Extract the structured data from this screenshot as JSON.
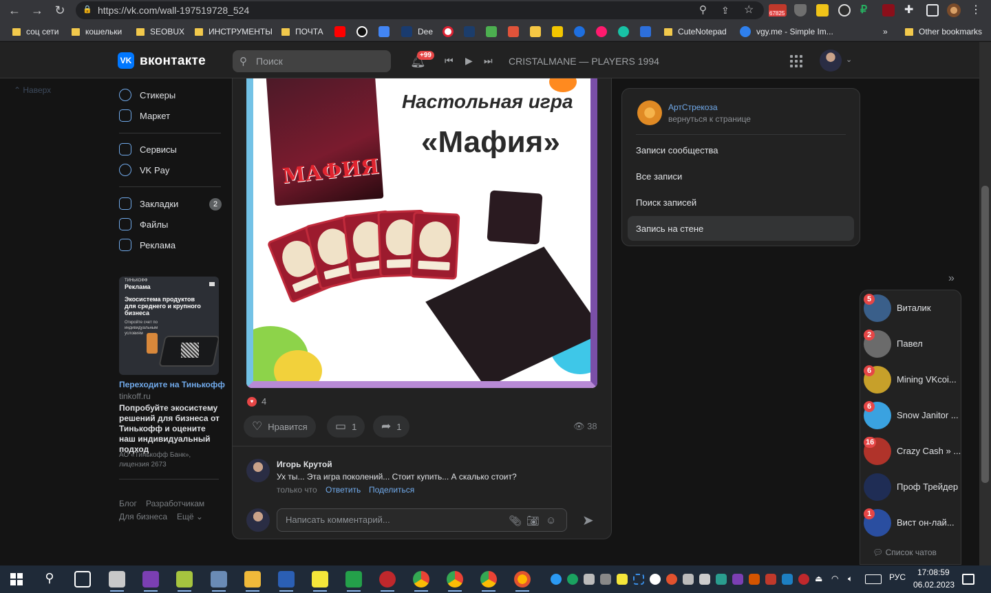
{
  "browser": {
    "url": "https://vk.com/wall-197519728_524",
    "mail_badge": "67825",
    "bookmarks": [
      "соц сети",
      "кошельки",
      "SEOBUX",
      "ИНСТРУМЕНТЫ",
      "ПОЧТА",
      "Dee",
      "CuteNotepad",
      "vgy.me - Simple Im...",
      "Other bookmarks"
    ],
    "bookmarks_overflow": "»"
  },
  "header": {
    "brand": "вконтакте",
    "logo": "VK",
    "search_placeholder": "Поиск",
    "notif_badge": "+99",
    "track": "CRISTALMANE — PLAYERS 1994"
  },
  "left_nav": {
    "up_label": "Наверх",
    "items": [
      {
        "label": "Стикеры",
        "icon": "smile-icon"
      },
      {
        "label": "Маркет",
        "icon": "bag-icon"
      },
      {
        "label": "Сервисы",
        "icon": "grid-icon"
      },
      {
        "label": "VK Pay",
        "icon": "rouble-icon"
      },
      {
        "label": "Закладки",
        "icon": "bookmark-icon",
        "count": "2"
      },
      {
        "label": "Файлы",
        "icon": "file-icon"
      },
      {
        "label": "Реклама",
        "icon": "megaphone-icon"
      }
    ]
  },
  "ad": {
    "brand_tag": "ТИНЬКОФФ",
    "label": "Реклама",
    "heading": "Экосистема продуктов для среднего и крупного бизнеса",
    "small": "Откройте счет по индивидуальным условиям",
    "link": "Переходите на Тинькофф",
    "domain": "tinkoff.ru",
    "text": "Попробуйте экосистему решений для бизнеса от Тинькофф и оцените наш индивидуальный подход",
    "legal": "АО «Тинькофф Банк», лицензия 2673"
  },
  "footer_links": [
    "Блог",
    "Разработчикам",
    "Для бизнеса",
    "Ещё ⌄"
  ],
  "post": {
    "image_title1": "Настольная игра",
    "image_title2": "«Мафия»",
    "box_title": "МАФИЯ",
    "likes_count": "4",
    "like_label": "Нравится",
    "comments_count": "1",
    "shares_count": "1",
    "views": "38"
  },
  "comment": {
    "author": "Игорь Крутой",
    "text": "Ух ты... Эта игра поколений... Стоит купить... А скалько стоит?",
    "meta": "только что",
    "reply": "Ответить",
    "share": "Поделиться",
    "input_placeholder": "Написать комментарий..."
  },
  "filter": {
    "group_name": "АртСтрекоза",
    "back_label": "вернуться к странице",
    "items": [
      "Записи сообщества",
      "Все записи",
      "Поиск записей",
      "Запись на стене"
    ]
  },
  "chats": {
    "items": [
      {
        "name": "Виталик",
        "badge": "5",
        "color": "#3a5f8a"
      },
      {
        "name": "Павел",
        "badge": "2",
        "color": "#6b6b6b"
      },
      {
        "name": "Mining VKcoi...",
        "badge": "6",
        "color": "#c7a02a"
      },
      {
        "name": "Snow Janitor ...",
        "badge": "6",
        "color": "#3aa2e0"
      },
      {
        "name": "Crazy Cash » ...",
        "badge": "16",
        "color": "#b0332a"
      },
      {
        "name": "Проф Трейдер",
        "badge": "",
        "color": "#1f2d55"
      },
      {
        "name": "Вист он-лай...",
        "badge": "1",
        "color": "#2a4ea0"
      }
    ],
    "list_label": "Список чатов"
  },
  "taskbar": {
    "lang": "РУС",
    "time": "17:08:59",
    "date": "06.02.2023"
  }
}
